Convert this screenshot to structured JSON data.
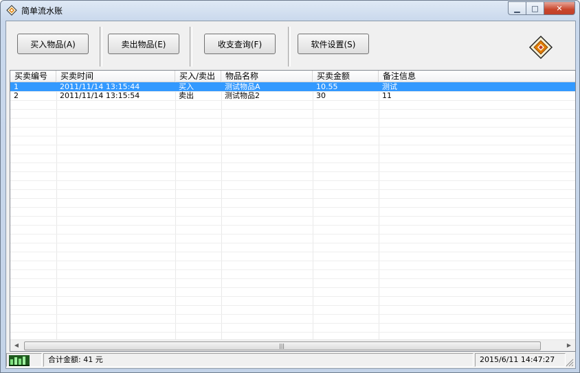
{
  "window": {
    "title": "简单流水账",
    "min_symbol": "▁",
    "max_symbol": "□",
    "close_symbol": "✕"
  },
  "toolbar": {
    "buy_label": "买入物品(A)",
    "sell_label": "卖出物品(E)",
    "query_label": "收支查询(F)",
    "settings_label": "软件设置(S)"
  },
  "table": {
    "columns": [
      "买卖编号",
      "买卖时间",
      "买入/卖出",
      "物品名称",
      "买卖金额",
      "备注信息"
    ],
    "rows": [
      [
        "1",
        "2011/11/14 13:15:44",
        "买入",
        "测试物品A",
        "10.55",
        "测试"
      ],
      [
        "2",
        "2011/11/14 13:15:54",
        "卖出",
        "测试物品2",
        "30",
        "11"
      ]
    ],
    "selected_row": 0
  },
  "scrollbar": {
    "left_arrow": "◀",
    "right_arrow": "▶",
    "grip": "|||"
  },
  "status": {
    "total": "合计金额: 41 元",
    "datetime": "2015/6/11 14:47:27"
  },
  "colors": {
    "selection": "#3399ff",
    "accent": "#e07b00"
  }
}
